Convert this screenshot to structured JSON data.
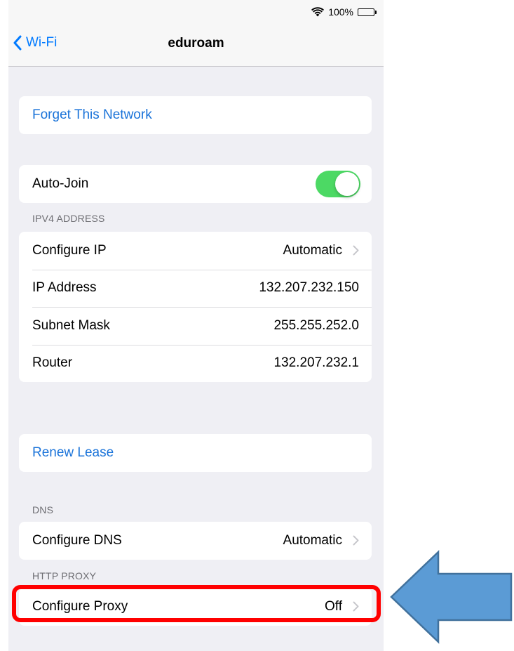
{
  "status_bar": {
    "battery_percent": "100%",
    "wifi_icon": "wifi-icon",
    "battery_icon": "battery-icon"
  },
  "nav": {
    "back_label": "Wi-Fi",
    "title": "eduroam"
  },
  "forget_network": {
    "label": "Forget This Network"
  },
  "auto_join": {
    "label": "Auto-Join",
    "enabled": true
  },
  "ipv4": {
    "header": "IPV4 ADDRESS",
    "rows": [
      {
        "label": "Configure IP",
        "value": "Automatic"
      },
      {
        "label": "IP Address",
        "value": "132.207.232.150"
      },
      {
        "label": "Subnet Mask",
        "value": "255.255.252.0"
      },
      {
        "label": "Router",
        "value": "132.207.232.1"
      }
    ]
  },
  "renew_lease": {
    "label": "Renew Lease"
  },
  "dns": {
    "header": "DNS",
    "label": "Configure DNS",
    "value": "Automatic"
  },
  "http_proxy": {
    "header": "HTTP PROXY",
    "label": "Configure Proxy",
    "value": "Off"
  },
  "colors": {
    "accent": "#007aff",
    "toggle_on": "#4cd964",
    "highlight": "#ff0000",
    "arrow_fill": "#5b9bd5",
    "arrow_stroke": "#41719c"
  }
}
